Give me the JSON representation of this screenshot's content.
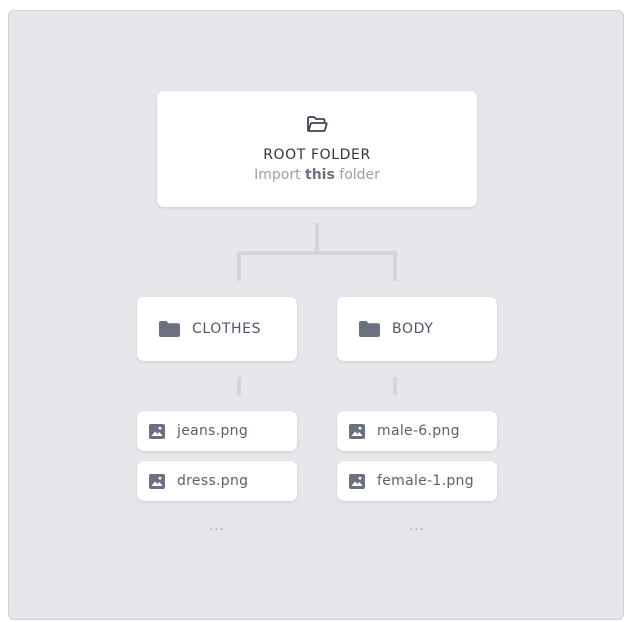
{
  "root": {
    "title": "ROOT FOLDER",
    "subtitle_prefix": "Import",
    "subtitle_bold": "this",
    "subtitle_suffix": "folder",
    "icon": "folder-open-icon"
  },
  "folders": [
    {
      "label": "CLOTHES",
      "icon": "folder-icon",
      "files": [
        {
          "name": "jeans.png",
          "icon": "image-icon"
        },
        {
          "name": "dress.png",
          "icon": "image-icon"
        }
      ],
      "more": "..."
    },
    {
      "label": "BODY",
      "icon": "folder-icon",
      "files": [
        {
          "name": "male-6.png",
          "icon": "image-icon"
        },
        {
          "name": "female-1.png",
          "icon": "image-icon"
        }
      ],
      "more": "..."
    }
  ],
  "colors": {
    "panel_bg": "#e6e7eb",
    "card_bg": "#ffffff",
    "connector": "#d3d5da",
    "icon": "#6b7180"
  }
}
